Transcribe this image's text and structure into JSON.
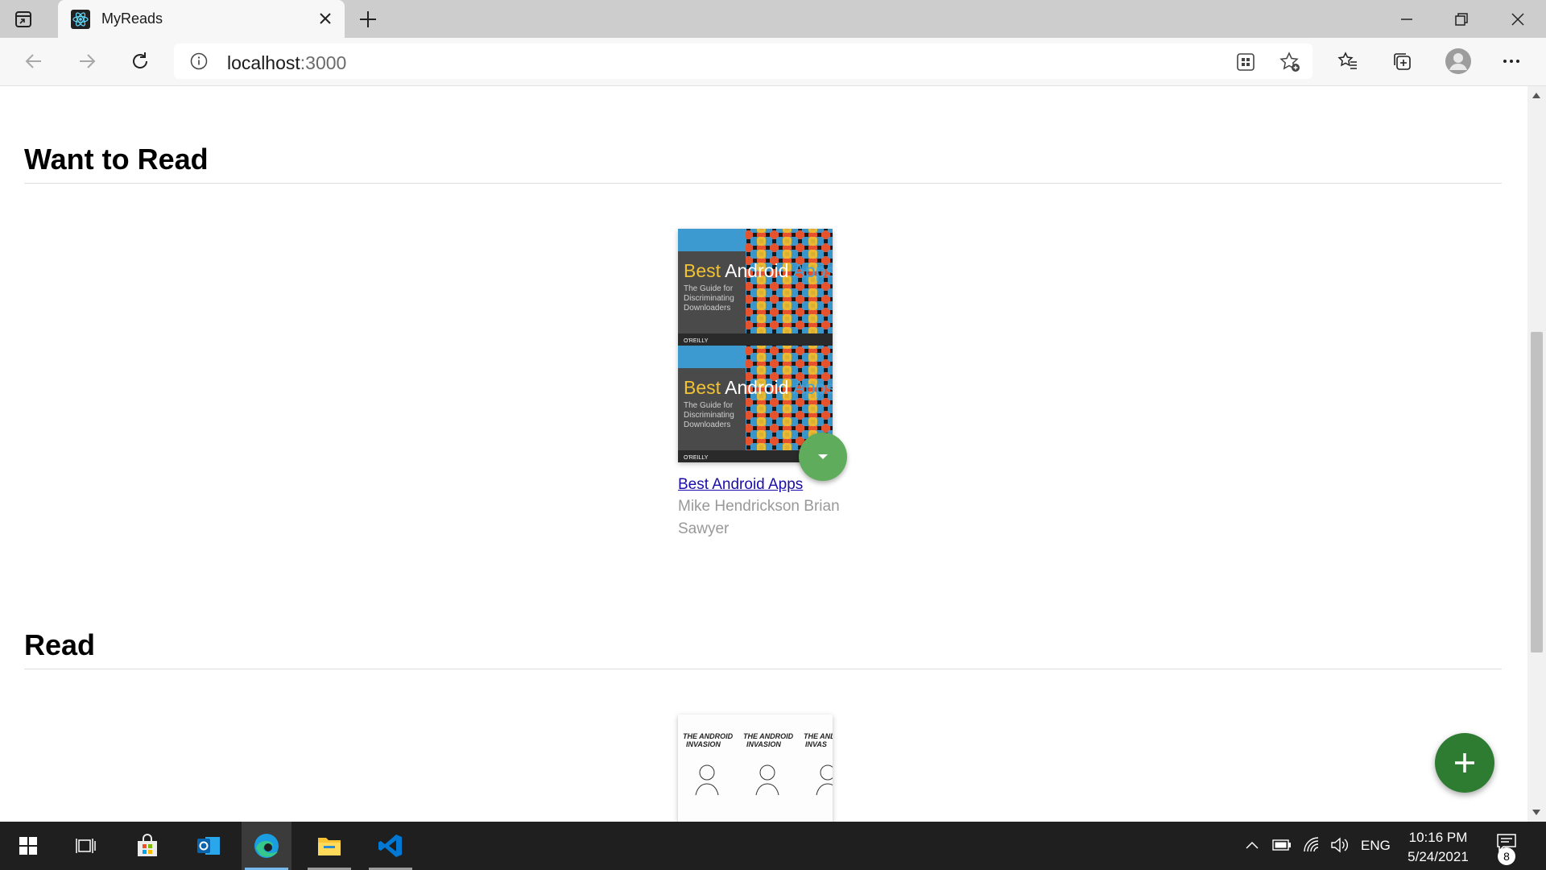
{
  "browser": {
    "tab_title": "MyReads",
    "address_host": "localhost",
    "address_port": ":3000"
  },
  "shelves": [
    {
      "title": "Want to Read",
      "books": [
        {
          "title": "Best Android Apps",
          "authors": "Mike Hendrickson Brian Sawyer",
          "cover_text_1": "Best Android Apps",
          "cover_text_2": "The Guide for Discriminating Downloaders",
          "cover_publisher": "O'REILLY"
        }
      ]
    },
    {
      "title": "Read",
      "books": [
        {
          "title": "The Android Invasion",
          "cover_text": "THE ANDROID INVASION"
        }
      ]
    }
  ],
  "taskbar": {
    "language": "ENG",
    "time": "10:16 PM",
    "date": "5/24/2021",
    "notification_count": "8"
  },
  "colors": {
    "shelf_changer": "#60ac5d",
    "open_search": "#2e7c31",
    "link": "#1a0dab"
  }
}
